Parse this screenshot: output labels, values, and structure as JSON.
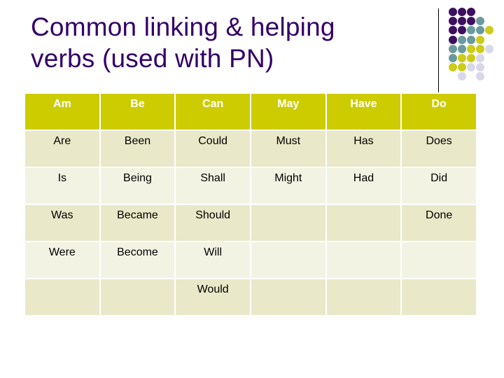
{
  "slide": {
    "title_line1": "Common linking & helping",
    "title_line2": "verbs (used with PN)"
  },
  "colors": {
    "title": "#330066",
    "header_bg": "#cccc00",
    "row_dark": "#e9e8c8",
    "row_light": "#f3f3e4",
    "dot_purple": "#3d0f5e",
    "dot_teal": "#6b9a9c",
    "dot_yellow": "#cccc19",
    "dot_lavender": "#d8d8e8"
  },
  "decoration": {
    "dot_grid": [
      [
        "purple",
        "purple",
        "purple",
        null,
        null
      ],
      [
        "purple",
        "purple",
        "purple",
        "teal",
        null
      ],
      [
        "purple",
        "purple",
        "teal",
        "teal",
        "yellow"
      ],
      [
        "purple",
        "teal",
        "teal",
        "yellow",
        null
      ],
      [
        "teal",
        "teal",
        "yellow",
        "yellow",
        "lavender"
      ],
      [
        "teal",
        "yellow",
        "yellow",
        "lavender",
        null
      ],
      [
        "yellow",
        "yellow",
        "lavender",
        "lavender",
        null
      ],
      [
        null,
        "lavender",
        null,
        "lavender",
        null
      ]
    ]
  },
  "table": {
    "headers": [
      "Am",
      "Be",
      "Can",
      "May",
      "Have",
      "Do"
    ],
    "rows": [
      [
        "Are",
        "Been",
        "Could",
        "Must",
        "Has",
        "Does"
      ],
      [
        "Is",
        "Being",
        "Shall",
        "Might",
        "Had",
        "Did"
      ],
      [
        "Was",
        "Became",
        "Should",
        "",
        "",
        "Done"
      ],
      [
        "Were",
        "Become",
        "Will",
        "",
        "",
        ""
      ],
      [
        "",
        "",
        "Would",
        "",
        "",
        ""
      ]
    ]
  }
}
